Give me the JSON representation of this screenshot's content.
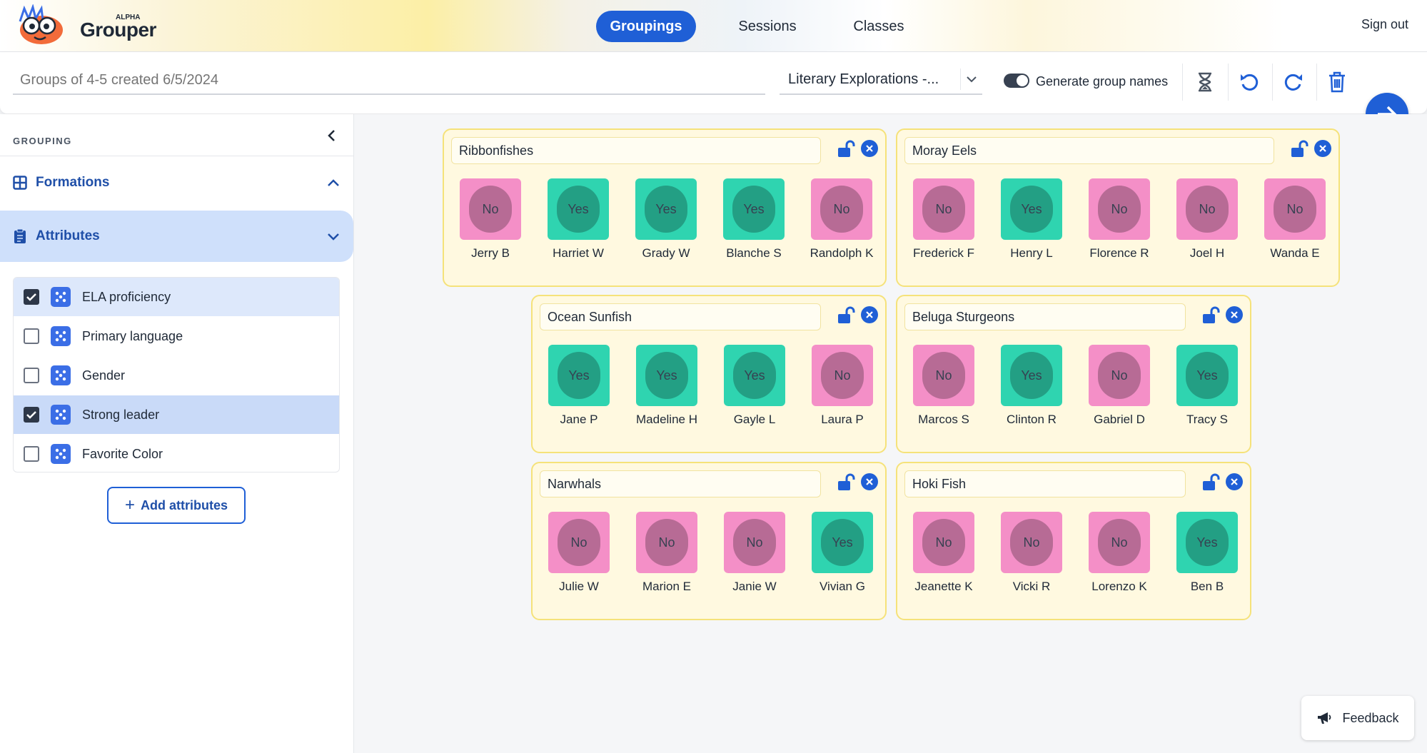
{
  "app": {
    "brand": "Grouper",
    "badge": "ALPHA"
  },
  "nav": {
    "groupings": "Groupings",
    "sessions": "Sessions",
    "classes": "Classes",
    "sign_out": "Sign out"
  },
  "toolbar": {
    "grouping_name_placeholder": "Groups of 4-5 created 6/5/2024",
    "class_select_value": "Literary Explorations -...",
    "generate_names_label": "Generate group names",
    "generate_names_on": true
  },
  "sidebar": {
    "title": "GROUPING",
    "formations_label": "Formations",
    "attributes_label": "Attributes",
    "attributes": [
      {
        "name": "ELA proficiency",
        "checked": true
      },
      {
        "name": "Primary language",
        "checked": false
      },
      {
        "name": "Gender",
        "checked": false
      },
      {
        "name": "Strong leader",
        "checked": true
      },
      {
        "name": "Favorite Color",
        "checked": false
      }
    ],
    "add_attributes_label": "Add attributes"
  },
  "groups": [
    {
      "name": "Ribbonfishes",
      "students": [
        {
          "name": "Jerry B",
          "value": "No"
        },
        {
          "name": "Harriet W",
          "value": "Yes"
        },
        {
          "name": "Grady W",
          "value": "Yes"
        },
        {
          "name": "Blanche S",
          "value": "Yes"
        },
        {
          "name": "Randolph K",
          "value": "No"
        }
      ]
    },
    {
      "name": "Moray Eels",
      "students": [
        {
          "name": "Frederick F",
          "value": "No"
        },
        {
          "name": "Henry L",
          "value": "Yes"
        },
        {
          "name": "Florence R",
          "value": "No"
        },
        {
          "name": "Joel H",
          "value": "No"
        },
        {
          "name": "Wanda E",
          "value": "No"
        }
      ]
    },
    {
      "name": "Ocean Sunfish",
      "students": [
        {
          "name": "Jane P",
          "value": "Yes"
        },
        {
          "name": "Madeline H",
          "value": "Yes"
        },
        {
          "name": "Gayle L",
          "value": "Yes"
        },
        {
          "name": "Laura P",
          "value": "No"
        }
      ]
    },
    {
      "name": "Beluga Sturgeons",
      "students": [
        {
          "name": "Marcos S",
          "value": "No"
        },
        {
          "name": "Clinton R",
          "value": "Yes"
        },
        {
          "name": "Gabriel D",
          "value": "No"
        },
        {
          "name": "Tracy S",
          "value": "Yes"
        }
      ]
    },
    {
      "name": "Narwhals",
      "students": [
        {
          "name": "Julie W",
          "value": "No"
        },
        {
          "name": "Marion E",
          "value": "No"
        },
        {
          "name": "Janie W",
          "value": "No"
        },
        {
          "name": "Vivian G",
          "value": "Yes"
        }
      ]
    },
    {
      "name": "Hoki Fish",
      "students": [
        {
          "name": "Jeanette K",
          "value": "No"
        },
        {
          "name": "Vicki R",
          "value": "No"
        },
        {
          "name": "Lorenzo K",
          "value": "No"
        },
        {
          "name": "Ben B",
          "value": "Yes"
        }
      ]
    }
  ],
  "feedback_label": "Feedback",
  "colors": {
    "accent": "#1f5fd6",
    "no": "#f48fc7",
    "yes": "#2fd4b0",
    "group_bg": "#fff9e0",
    "group_border": "#f5e27a"
  }
}
